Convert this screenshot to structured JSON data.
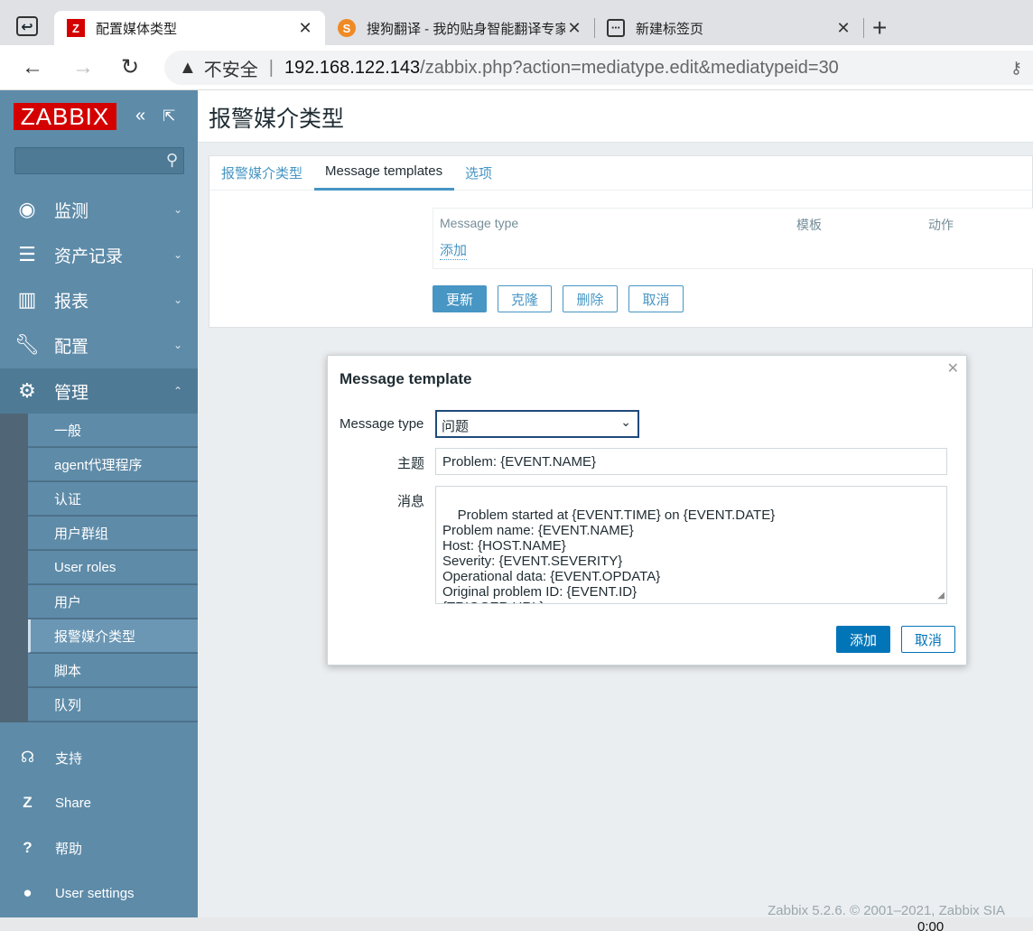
{
  "browser": {
    "tabs": [
      {
        "title": "配置媒体类型",
        "favicon": "Z",
        "active": true
      },
      {
        "title": "搜狗翻译 - 我的贴身智能翻译专家",
        "favicon": "S",
        "active": false
      },
      {
        "title": "新建标签页",
        "favicon": "▣",
        "active": false
      }
    ],
    "security_label": "不安全",
    "url_host": "192.168.122.143",
    "url_path": "/zabbix.php?action=mediatype.edit&mediatypeid=30"
  },
  "sidebar": {
    "logo": "ZABBIX",
    "menu": [
      {
        "label": "监测",
        "icon": "eye-icon"
      },
      {
        "label": "资产记录",
        "icon": "list-icon"
      },
      {
        "label": "报表",
        "icon": "bar-chart-icon"
      },
      {
        "label": "配置",
        "icon": "wrench-icon"
      },
      {
        "label": "管理",
        "icon": "gear-icon"
      }
    ],
    "submenu": [
      "一般",
      "agent代理程序",
      "认证",
      "用户群组",
      "User roles",
      "用户",
      "报警媒介类型",
      "脚本",
      "队列"
    ],
    "selected_submenu": "报警媒介类型",
    "bottom": [
      {
        "label": "支持",
        "icon": "headset-icon"
      },
      {
        "label": "Share",
        "icon": "share-icon"
      },
      {
        "label": "帮助",
        "icon": "help-icon"
      },
      {
        "label": "User settings",
        "icon": "user-icon"
      }
    ]
  },
  "page": {
    "title": "报警媒介类型",
    "tabs": [
      "报警媒介类型",
      "Message templates",
      "选项"
    ],
    "active_tab": "Message templates",
    "table_headers": [
      "Message type",
      "模板",
      "动作"
    ],
    "add_link": "添加",
    "buttons": {
      "update": "更新",
      "clone": "克隆",
      "delete": "删除",
      "cancel": "取消"
    }
  },
  "dialog": {
    "title": "Message template",
    "message_type_label": "Message type",
    "message_type_value": "问题",
    "subject_label": "主题",
    "subject_value": "Problem: {EVENT.NAME}",
    "message_label": "消息",
    "message_value": "Problem started at {EVENT.TIME} on {EVENT.DATE}\nProblem name: {EVENT.NAME}\nHost: {HOST.NAME}\nSeverity: {EVENT.SEVERITY}\nOperational data: {EVENT.OPDATA}\nOriginal problem ID: {EVENT.ID}\n{TRIGGER.URL}",
    "add_button": "添加",
    "cancel_button": "取消"
  },
  "footer": "Zabbix 5.2.6. © 2001–2021, Zabbix SIA",
  "taskbar_clock": "0:00",
  "colors": {
    "sidebar": "#5e8ba8",
    "accent": "#4796c4",
    "primary_dialog": "#0275b8",
    "logo": "#d40000"
  }
}
